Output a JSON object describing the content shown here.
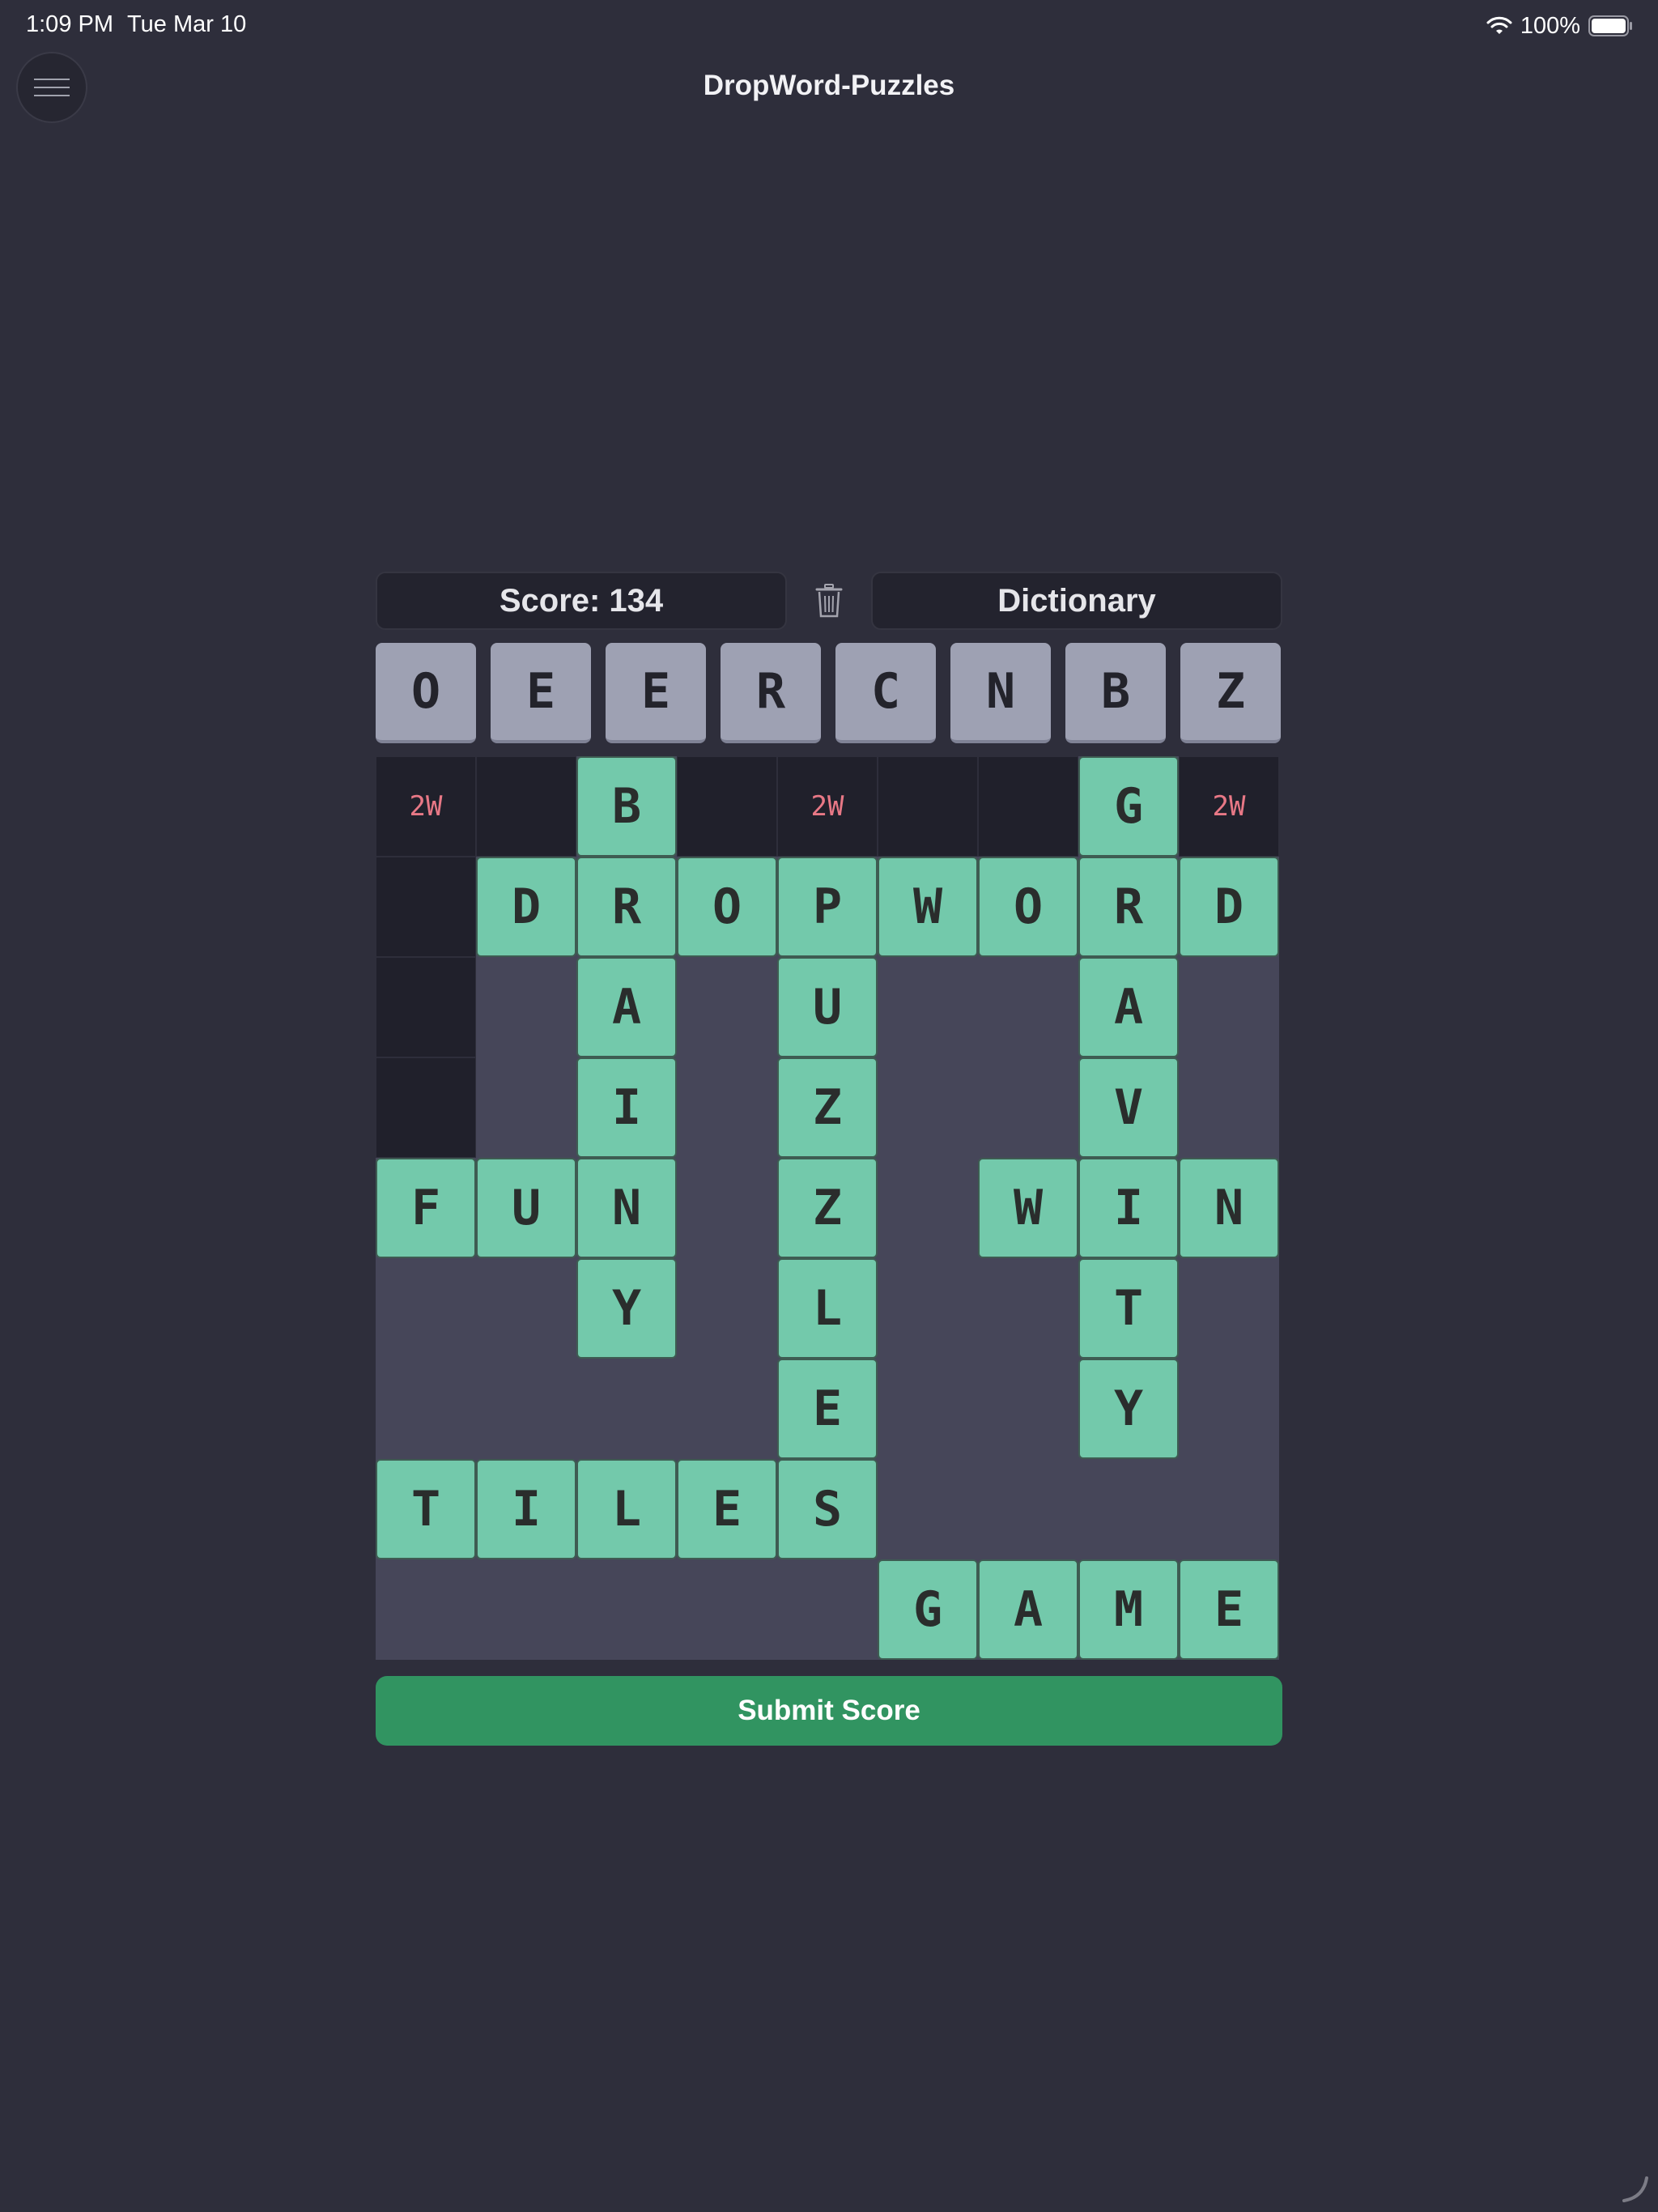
{
  "status": {
    "time": "1:09 PM",
    "date": "Tue Mar 10",
    "battery": "100%"
  },
  "app": {
    "title": "DropWord-Puzzles"
  },
  "score_label": "Score: 134",
  "dictionary_label": "Dictionary",
  "submit_label": "Submit Score",
  "rack": [
    "O",
    "E",
    "E",
    "R",
    "C",
    "N",
    "B",
    "Z"
  ],
  "bonus_label": "2W",
  "board": {
    "rows": 9,
    "cols": 9,
    "grid": [
      "..B....G.",
      ".DROPWORD",
      "..A.U..A.",
      "..I.Z..V.",
      "FUN.Z.WIN",
      "..Y.L..T.",
      "....E..Y.",
      "TILES....",
      ".....GAME"
    ],
    "empty_cells": [
      [
        0,
        0
      ],
      [
        0,
        1
      ],
      [
        0,
        3
      ],
      [
        0,
        4
      ],
      [
        0,
        5
      ],
      [
        0,
        6
      ],
      [
        0,
        8
      ],
      [
        1,
        0
      ],
      [
        2,
        0
      ],
      [
        3,
        0
      ]
    ],
    "bonus_cells": [
      [
        0,
        0
      ],
      [
        0,
        4
      ],
      [
        0,
        8
      ]
    ]
  },
  "colors": {
    "tile": "#73c9ab",
    "bonus": "#e87886",
    "submit": "#319461",
    "rack_tile": "#9ea1b3"
  }
}
